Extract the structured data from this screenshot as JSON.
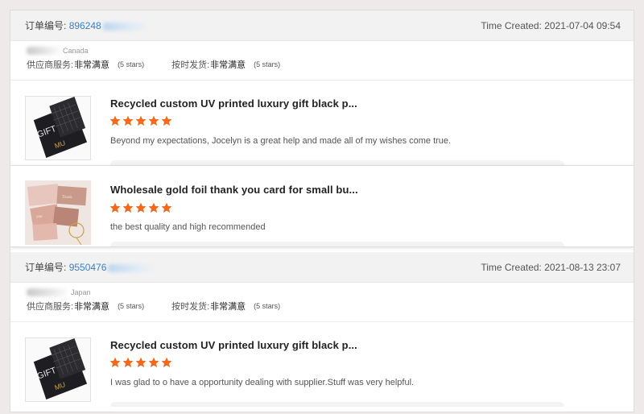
{
  "orders": [
    {
      "order_label": "订单编号:",
      "order_id": "896248",
      "time_label": "Time Created:",
      "time": "2021-07-04 09:54",
      "country": "Canada",
      "supplier_service_label": "供应商服务:",
      "supplier_service_value": "非常满意",
      "supplier_service_stars": "(5 stars)",
      "shipping_label": "按时发货:",
      "shipping_value": "非常满意",
      "shipping_stars": "(5 stars)",
      "items": [
        {
          "title": "Recycled custom UV printed luxury gift black p...",
          "rating": 5,
          "comment": "Beyond my expectations, Jocelyn is a great help and made all of my wishes come true."
        },
        {
          "title": "Wholesale gold foil thank you card for small bu...",
          "rating": 5,
          "comment": "the best quality and high recommended"
        }
      ]
    },
    {
      "order_label": "订单编号:",
      "order_id": "9550476",
      "time_label": "Time Created:",
      "time": "2021-08-13 23:07",
      "country": "Japan",
      "supplier_service_label": "供应商服务:",
      "supplier_service_value": "非常满意",
      "supplier_service_stars": "(5 stars)",
      "shipping_label": "按时发货:",
      "shipping_value": "非常满意",
      "shipping_stars": "(5 stars)",
      "items": [
        {
          "title": "Recycled custom UV printed luxury gift black p...",
          "rating": 5,
          "comment": "I was glad to o have a opportunity dealing with supplier.Stuff was very helpful."
        }
      ]
    }
  ],
  "colors": {
    "star": "#f26a1b",
    "link": "#3b7fc4",
    "header_bg": "#f2f2f2"
  }
}
